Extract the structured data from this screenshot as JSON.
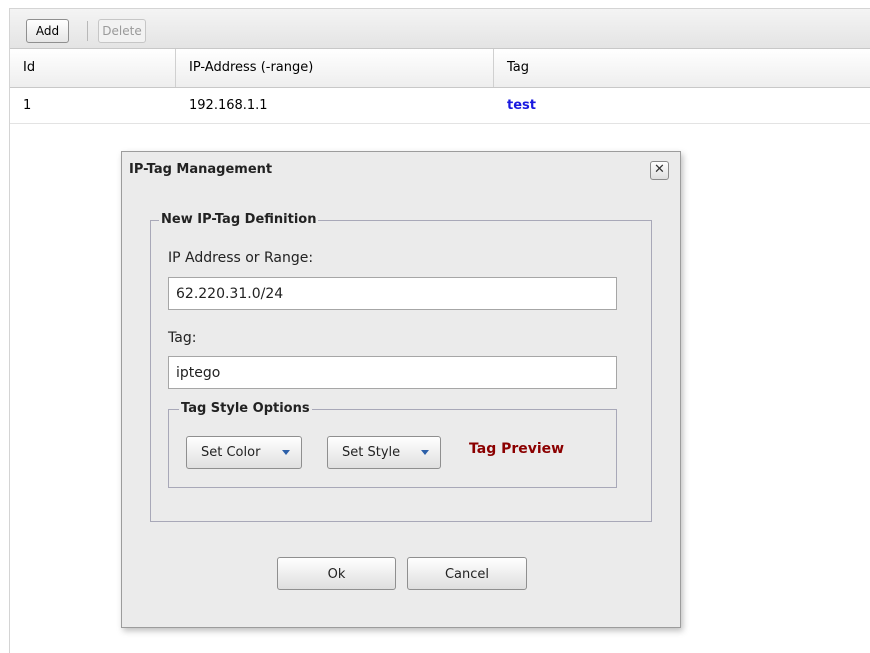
{
  "toolbar": {
    "add_label": "Add",
    "delete_label": "Delete"
  },
  "table": {
    "columns": [
      "Id",
      "IP-Address (-range)",
      "Tag"
    ],
    "rows": [
      {
        "id": "1",
        "ip": "192.168.1.1",
        "tag": "test",
        "tag_color": "#1a1ae0"
      }
    ]
  },
  "dialog": {
    "title": "IP-Tag Management",
    "close_icon": "close-x",
    "fieldset_legend": "New IP-Tag Definition",
    "ip_label": "IP Address or Range:",
    "ip_value": "62.220.31.0/24",
    "tag_label": "Tag:",
    "tag_value": "iptego",
    "style_legend": "Tag Style Options",
    "set_color_label": "Set Color",
    "set_style_label": "Set Style",
    "preview_label": "Tag Preview",
    "preview_color": "#8b0000",
    "ok_label": "Ok",
    "cancel_label": "Cancel"
  }
}
